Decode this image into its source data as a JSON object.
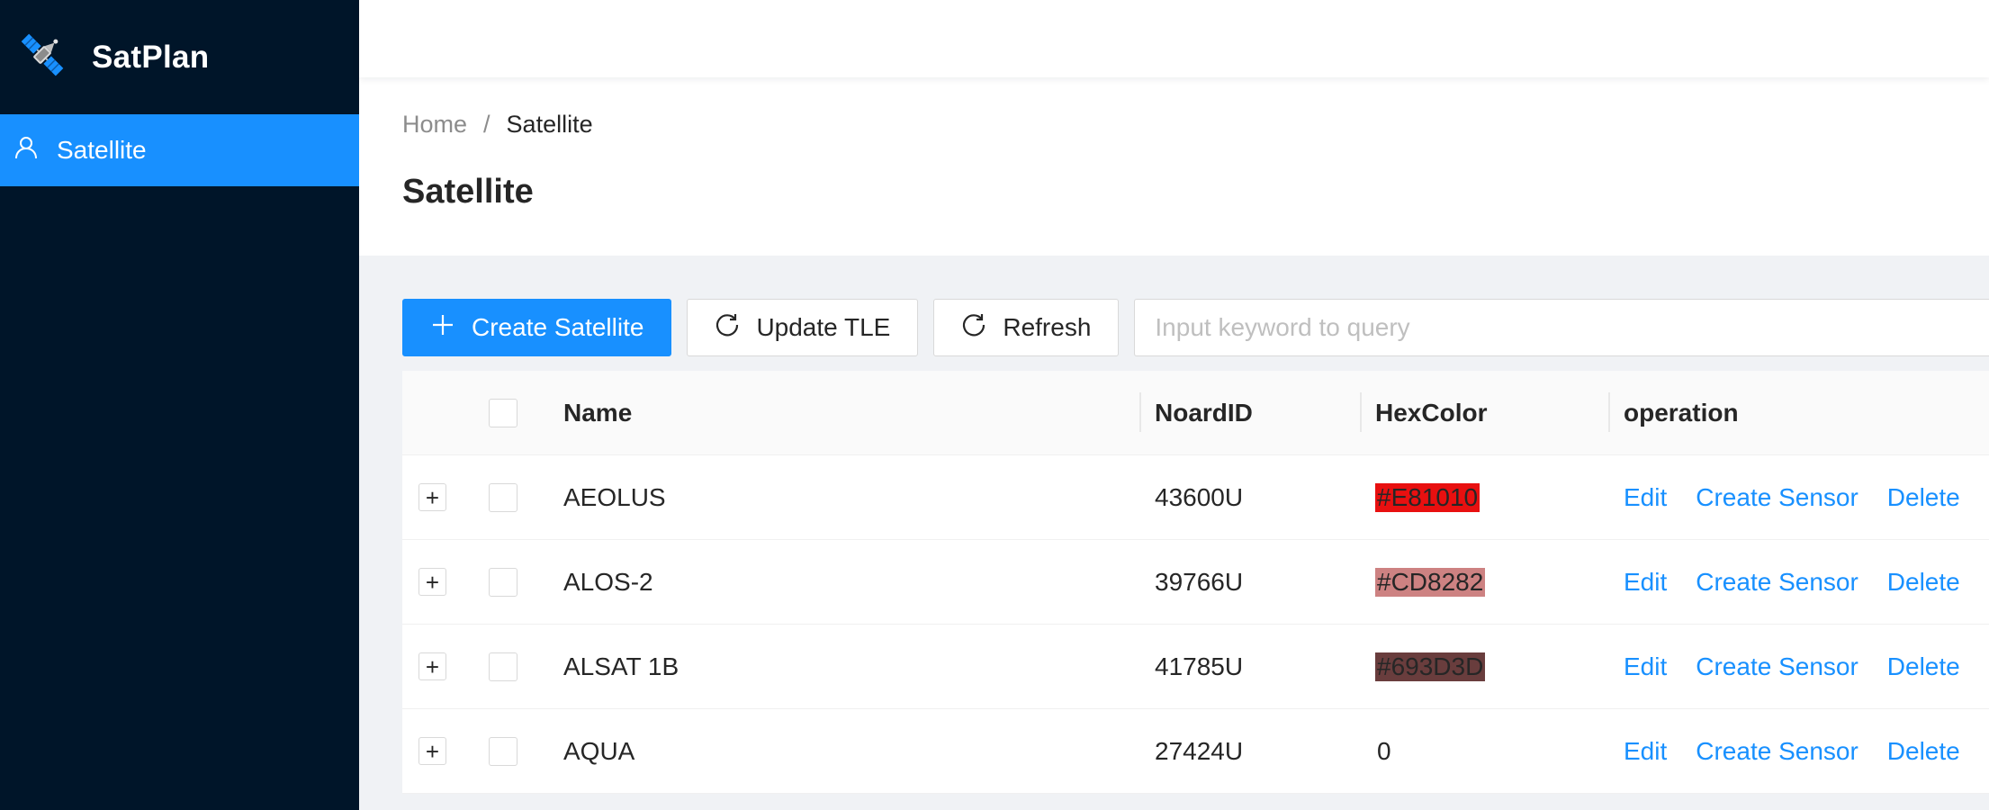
{
  "app": {
    "title": "SatPlan",
    "logo_icon": "satellite-icon"
  },
  "sidebar": {
    "items": [
      {
        "label": "Satellite",
        "icon": "user-icon",
        "active": true
      }
    ]
  },
  "breadcrumb": {
    "home": "Home",
    "separator": "/",
    "current": "Satellite"
  },
  "page": {
    "title": "Satellite"
  },
  "toolbar": {
    "create_label": "Create Satellite",
    "update_label": "Update TLE",
    "refresh_label": "Refresh",
    "search_placeholder": "Input keyword to query",
    "search_value": ""
  },
  "table": {
    "columns": {
      "name": "Name",
      "noard": "NoardID",
      "hex": "HexColor",
      "operation": "operation"
    },
    "actions": {
      "edit": "Edit",
      "create_sensor": "Create Sensor",
      "delete": "Delete"
    },
    "rows": [
      {
        "name": "AEOLUS",
        "noard": "43600U",
        "hex": "#E81010",
        "hex_bg": "#E81010"
      },
      {
        "name": "ALOS-2",
        "noard": "39766U",
        "hex": "#CD8282",
        "hex_bg": "#CD8282"
      },
      {
        "name": "ALSAT 1B",
        "noard": "41785U",
        "hex": "#693D3D",
        "hex_bg": "#693D3D"
      },
      {
        "name": "AQUA",
        "noard": "27424U",
        "hex": "0",
        "hex_bg": ""
      }
    ]
  },
  "colors": {
    "sidebar_bg": "#001529",
    "primary": "#1890ff"
  }
}
